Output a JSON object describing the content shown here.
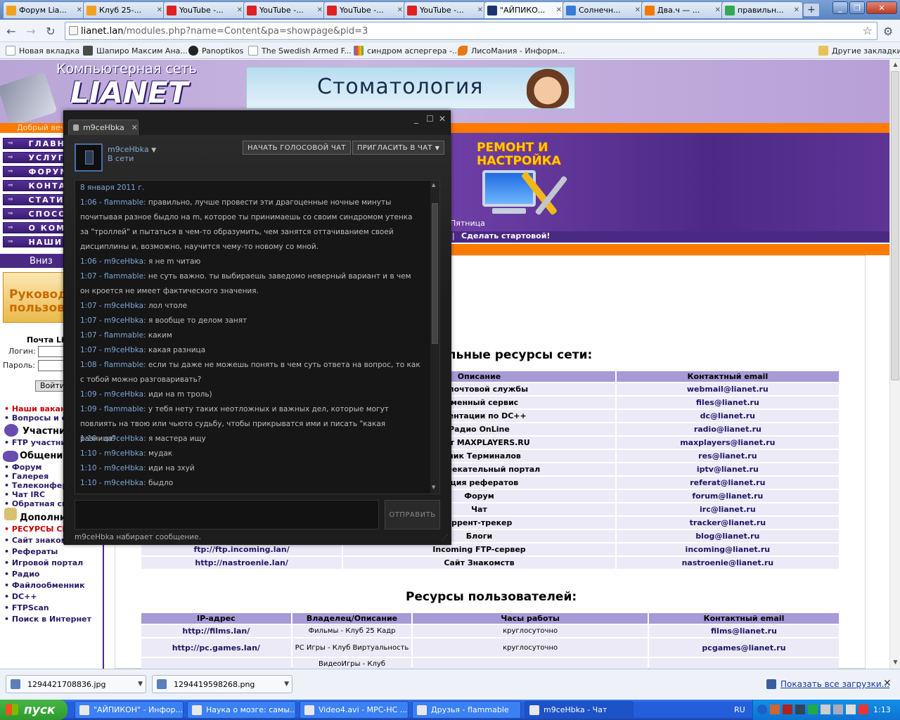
{
  "browser": {
    "tabs": [
      {
        "title": "Форум Lia...",
        "icon": "forum-favicon",
        "color": "#f2a020"
      },
      {
        "title": "Клуб 25-...",
        "icon": "club-favicon",
        "color": "#f2a020"
      },
      {
        "title": "YouTube -...",
        "icon": "youtube-favicon",
        "color": "#d22"
      },
      {
        "title": "YouTube -...",
        "icon": "youtube-favicon",
        "color": "#d22"
      },
      {
        "title": "YouTube -...",
        "icon": "youtube-favicon",
        "color": "#d22"
      },
      {
        "title": "YouTube -...",
        "icon": "youtube-favicon",
        "color": "#d22"
      },
      {
        "title": "\"АЙПИКО...",
        "icon": "aipikon-favicon",
        "color": "#1b3570"
      },
      {
        "title": "Солнечн...",
        "icon": "sun-favicon",
        "color": "#3a7bd5"
      },
      {
        "title": "Два.ч — ...",
        "icon": "lightning-favicon",
        "color": "#f07a00"
      },
      {
        "title": "правильн...",
        "icon": "google-favicon",
        "color": "#34a853"
      }
    ],
    "url_host": "lianet.lan",
    "url_rest": "/modules.php?name=Content&pa=showpage&pid=3",
    "bookmarks": [
      {
        "label": "Новая вкладка"
      },
      {
        "label": "Шапиро Максим Ана..."
      },
      {
        "label": "Panoptikos"
      },
      {
        "label": "The Swedish Armed F..."
      },
      {
        "label": "синдром аспергера -..."
      },
      {
        "label": "ЛисоМания - Информ..."
      }
    ],
    "other_bookmarks": "Другие закладки"
  },
  "site": {
    "logo_small": "Компьютерная сеть",
    "logo_big": "LIANET",
    "ad_text": "Стоматология",
    "welcome": "Добрый веч",
    "repair": "РЕМОНТ И НАСТРОЙКА",
    "day": "Пятница",
    "startpage": "Сделать стартовой!",
    "nav": [
      "ГЛАВНА",
      "УСЛУГИ",
      "ФОРУМ",
      "КОНТАК",
      "СТАТИС",
      "СПОСОБЫ",
      "О КОМП",
      "НАШИ Р"
    ],
    "down": "Вниз",
    "guide": "Руковод пользова",
    "mail_title": "Почта Lia",
    "login_label": "Логин:",
    "password_label": "Пароль:",
    "login_button": "Войти",
    "left_links": [
      {
        "text": "• Наши вакансии",
        "red": true
      },
      {
        "text": "• Вопросы и от",
        "red": false
      }
    ],
    "sections": [
      {
        "title": "Участни",
        "links": [
          "• FTP участник"
        ]
      },
      {
        "title": "Общение",
        "links": [
          "• Форум",
          "• Галерея",
          "• Телеконфере",
          "• Чат IRC",
          "• Обратная свя"
        ]
      },
      {
        "title": "Дополнит",
        "links": [
          "• РЕСУРСЫ СЕТ",
          "• Сайт знакомст",
          "• Рефераты",
          "• Игровой портал",
          "• Радио",
          "• Файлообменник",
          "• DC++",
          "• FTPScan",
          "• Поиск в Интернет"
        ]
      }
    ],
    "network_heading": "льные ресурсы сети:",
    "network_table": {
      "headers": [
        "Описание",
        "Контактный email"
      ],
      "rows": [
        {
          "url": "",
          "desc": "вер почтовой службы",
          "email": "webmail@lianet.ru"
        },
        {
          "url": "",
          "desc": "обменный сервис",
          "email": "files@lianet.ru"
        },
        {
          "url": "",
          "desc": "кументации по DC++",
          "email": "dc@lianet.ru"
        },
        {
          "url": "",
          "desc": "Радио OnLine",
          "email": "radio@lianet.ru"
        },
        {
          "url": "",
          "desc": "роект MAXPLAYERS.RU",
          "email": "maxplayers@lianet.ru"
        },
        {
          "url": "",
          "desc": "очник Терминалов",
          "email": "res@lianet.ru"
        },
        {
          "url": "",
          "desc": "й развлекательный портал",
          "email": "iptv@lianet.ru"
        },
        {
          "url": "",
          "desc": "екция рефератов",
          "email": "referat@lianet.ru"
        },
        {
          "url": "",
          "desc": "Форум",
          "email": "forum@lianet.ru"
        },
        {
          "url": "",
          "desc": "Чат",
          "email": "irc@lianet.ru"
        },
        {
          "url": "",
          "desc": "оррент-трекер",
          "email": "tracker@lianet.ru"
        },
        {
          "url": "",
          "desc": "Блоги",
          "email": "blog@lianet.ru"
        },
        {
          "url": "ftp://ftp.incoming.lan/",
          "desc": "Incoming FTP-сервер",
          "email": "incoming@lianet.ru"
        },
        {
          "url": "http://nastroenie.lan/",
          "desc": "Сайт Знакомств",
          "email": "nastroenie@lianet.ru"
        }
      ]
    },
    "users_heading": "Ресурсы пользователей:",
    "users_table": {
      "headers": [
        "IP-адрес",
        "Владелец/Описание",
        "Часы работы",
        "Контактный email"
      ],
      "rows": [
        {
          "ip": "http://films.lan/",
          "owner": "Фильмы - Клуб 25 Кадр",
          "hours": "круглосуточно",
          "email": "films@lianet.ru"
        },
        {
          "ip": "http://pc.games.lan/",
          "owner": "PC Игры - Клуб Виртуальность",
          "hours": "круглосуточно",
          "email": "pcgames@lianet.ru"
        },
        {
          "ip": "",
          "owner": "ВидеоИгры - Клуб",
          "hours": "",
          "email": ""
        }
      ]
    }
  },
  "chat": {
    "tab_title": "m9ceHbka",
    "contact_name": "m9ceHbka",
    "status": "В сети",
    "voice_button": "НАЧАТЬ ГОЛОСОВОЙ ЧАТ",
    "invite_button": "ПРИГЛАСИТЬ В ЧАТ",
    "date": "8 января 2011 г.",
    "messages": [
      {
        "ts": "1:06 - flammable:",
        "text": " правильно, лучше провести эти драгоценные ночные минуты почитывая разное быдло на m, которое ты принимаешь  со своим синдромом утенка за \"троллей\" и пытаться в чем-то образумить, чем занятся оттачиванием своей дисциплины и, возможно, научится чему-то новому со мной."
      },
      {
        "ts": "1:06 - m9ceHbka:",
        "text": " я не m читаю"
      },
      {
        "ts": "1:07 - flammable:",
        "text": " не суть важно. ты выбираешь заведомо неверный вариант и в чем он кроется не имеет фактического значения."
      },
      {
        "ts": "1:07 - m9ceHbka:",
        "text": " лол чтоле"
      },
      {
        "ts": "1:07 - m9ceHbka:",
        "text": " я вообще то делом занят"
      },
      {
        "ts": "1:07 - flammable:",
        "text": " каким"
      },
      {
        "ts": "1:07 - m9ceHbka:",
        "text": " какая разница"
      },
      {
        "ts": "1:08 - flammable:",
        "text": " если ты даже не можешь понять в чем суть ответа на вопрос, то как с тобой можно разговаривать?"
      },
      {
        "ts": "1:09 - m9ceHbka:",
        "text": " иди на m троль)"
      },
      {
        "ts": "1:09 - flammable:",
        "text": " у тебя нету таких неотложных и важных дел, которые могут повлиять на твою или чьюто судьбу, чтобы прикрыватся ими и писать \"какая разница\""
      },
      {
        "ts": "1:10 - m9ceHbka:",
        "text": " я мастера ищу"
      },
      {
        "ts": "1:10 - m9ceHbka:",
        "text": " мудак"
      },
      {
        "ts": "1:10 - m9ceHbka:",
        "text": " иди на зхуй"
      },
      {
        "ts": "1:10 - m9ceHbka:",
        "text": " быдло"
      }
    ],
    "send_button": "ОТПРАВИТЬ",
    "typing": "m9ceHbka набирает сообщение."
  },
  "downloads": {
    "items": [
      "1294421708836.jpg",
      "1294419598268.png"
    ],
    "show_all": "Показать все загрузки..."
  },
  "taskbar": {
    "start": "пуск",
    "tasks": [
      {
        "label": "\"АЙПИКОН\" - Инфор..."
      },
      {
        "label": "Наука о мозге: самы..."
      },
      {
        "label": "Video4.avi - MPC-HC ..."
      },
      {
        "label": "Друзья - flammable"
      },
      {
        "label": "m9ceHbka - Чат"
      }
    ],
    "lang": "RU",
    "clock": "1:13"
  }
}
